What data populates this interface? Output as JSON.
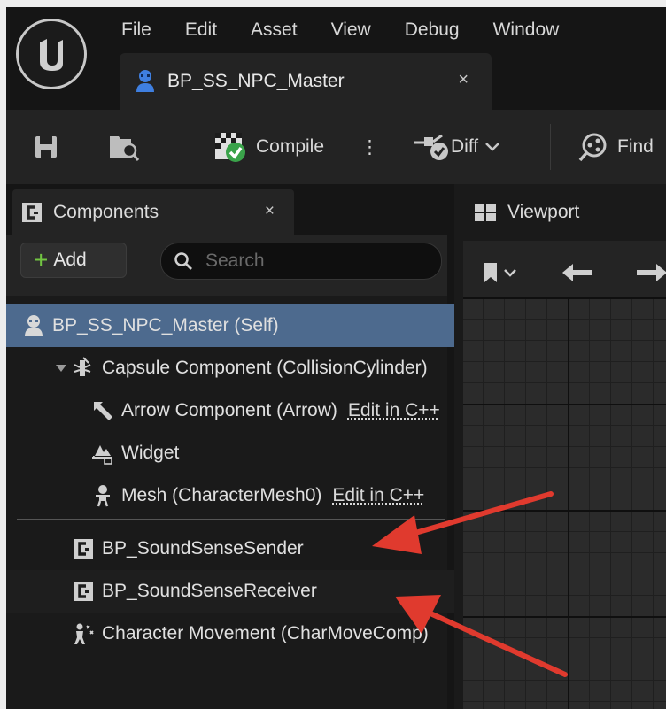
{
  "menubar": {
    "items": [
      "File",
      "Edit",
      "Asset",
      "View",
      "Debug",
      "Window"
    ]
  },
  "document_tab": {
    "label": "BP_SS_NPC_Master",
    "close": "×"
  },
  "toolbar": {
    "compile_label": "Compile",
    "more": "⋮",
    "diff_label": "Diff",
    "find_label": "Find"
  },
  "components_panel": {
    "tab_label": "Components",
    "tab_close": "×",
    "add_label": "Add",
    "search_placeholder": "Search",
    "items": [
      {
        "label": "BP_SS_NPC_Master (Self)",
        "icon": "pawn-self-icon"
      },
      {
        "label": "Capsule Component (CollisionCylinder)",
        "icon": "capsule-collision-icon",
        "expanded": true
      },
      {
        "label": "Arrow Component (Arrow)",
        "edit": "Edit in C++",
        "icon": "arrow-component-icon"
      },
      {
        "label": "Widget",
        "icon": "widget-icon"
      },
      {
        "label": "Mesh (CharacterMesh0)",
        "edit": "Edit in C++",
        "icon": "skeletal-mesh-icon"
      },
      {
        "label": "BP_SoundSenseSender",
        "icon": "actor-component-icon"
      },
      {
        "label": "BP_SoundSenseReceiver",
        "icon": "actor-component-icon"
      },
      {
        "label": "Character Movement (CharMoveComp)",
        "icon": "character-movement-icon"
      }
    ]
  },
  "viewport_panel": {
    "tab_label": "Viewport"
  },
  "colors": {
    "selected_row": "#4d6a8e",
    "add_plus": "#72c542",
    "annotation_arrow": "#e03a2e",
    "compile_ok": "#3aa34a",
    "tab_icon": "#3f7fe0"
  }
}
